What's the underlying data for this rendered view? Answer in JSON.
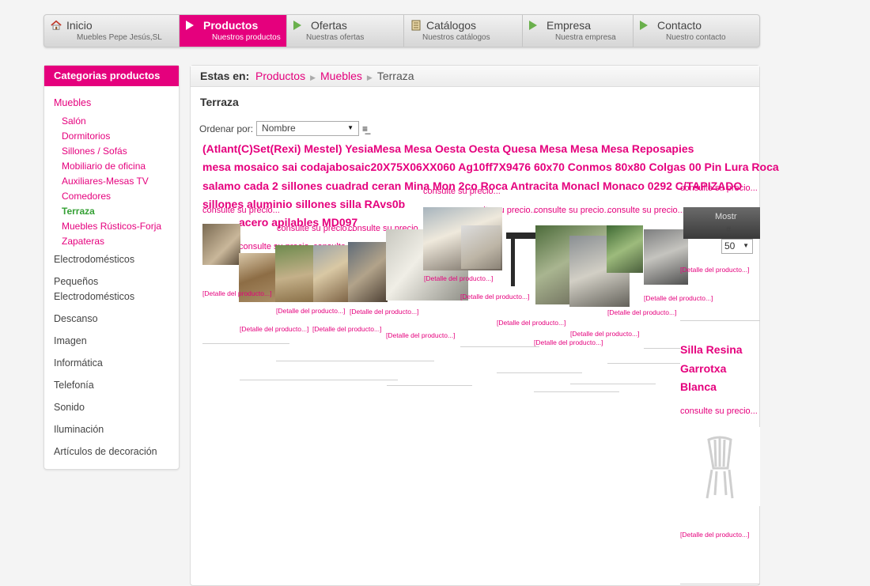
{
  "nav": [
    {
      "title": "Inicio",
      "sub": "Muebles Pepe Jesús,SL",
      "icon": "home-icon"
    },
    {
      "title": "Productos",
      "sub": "Nuestros productos",
      "icon": "arrow-icon"
    },
    {
      "title": "Ofertas",
      "sub": "Nuestras ofertas",
      "icon": "arrow-icon"
    },
    {
      "title": "Catálogos",
      "sub": "Nuestros catálogos",
      "icon": "catalog-icon"
    },
    {
      "title": "Empresa",
      "sub": "Nuestra empresa",
      "icon": "arrow-icon"
    },
    {
      "title": "Contacto",
      "sub": "Nuestro contacto",
      "icon": "arrow-icon"
    }
  ],
  "sidebar": {
    "title": "Categorias productos",
    "category": "Muebles",
    "subs": [
      "Salón",
      "Dormitorios",
      "Sillones / Sofás",
      "Mobiliario de oficina",
      "Auxiliares-Mesas TV",
      "Comedores",
      "Terraza",
      "Muebles Rústicos-Forja",
      "Zapateras"
    ],
    "items": [
      "Electrodomésticos",
      "Pequeños Electrodomésticos",
      "Descanso",
      "Imagen",
      "Informática",
      "Telefonía",
      "Sonido",
      "Iluminación",
      "Artículos de decoración"
    ]
  },
  "breadcrumb": {
    "label": "Estas en:",
    "p1": "Productos",
    "p2": "Muebles",
    "p3": "Terraza"
  },
  "page_title": "Terraza",
  "sort": {
    "label": "Ordenar por:",
    "value": "Nombre"
  },
  "perpage": {
    "head": "Mostr",
    "hash": "#",
    "value": "50"
  },
  "products": {
    "line1": "(Atlant(C)Set(Rexi) Mestel) YesiaMesa  Mesa  Oesta Oesta Quesa Mesa  Mesa Mesa  Reposapies",
    "line2": "mesa  mosaico sai codajabosaic20X75X06XX060 Ag10ff7X9476 60x70  Conmos 80x80 Colgas 00 Pin Lura Roca",
    "line3": "salamo cada 2 sillones cuadrad ceran Mina Mon 2co Roca  Antracita Monacl Monaco 0292  C/TAPIZADO",
    "line4": "sillones aluminio sillones silla RAvs0b",
    "line5": "acero  apilables  MD097",
    "price": "consulte su precio...",
    "detail": "[Detalle del producto...]",
    "last_name": [
      "Silla Resina",
      "Garrotxa",
      "Blanca"
    ]
  }
}
